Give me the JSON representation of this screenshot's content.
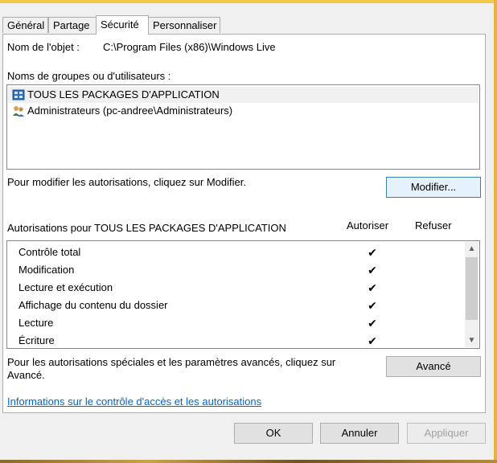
{
  "tabs": [
    {
      "label": "Général"
    },
    {
      "label": "Partage"
    },
    {
      "label": "Sécurité"
    },
    {
      "label": "Personnaliser"
    }
  ],
  "object_name": {
    "label": "Nom de l'objet :",
    "value": "C:\\Program Files (x86)\\Windows Live"
  },
  "groups": {
    "label": "Noms de groupes ou d'utilisateurs :",
    "items": [
      {
        "name": "TOUS LES PACKAGES D'APPLICATION",
        "icon": "app-packages-icon",
        "selected": true
      },
      {
        "name": "Administrateurs (pc-andree\\Administrateurs)",
        "icon": "users-group-icon",
        "selected": false
      }
    ]
  },
  "modify": {
    "hint": "Pour modifier les autorisations, cliquez sur Modifier.",
    "button": "Modifier..."
  },
  "permissions": {
    "title": "Autorisations pour TOUS LES PACKAGES D'APPLICATION",
    "allow_header": "Autoriser",
    "deny_header": "Refuser",
    "check_glyph": "✔",
    "rows": [
      {
        "name": "Contrôle total",
        "allow": true,
        "deny": false
      },
      {
        "name": "Modification",
        "allow": true,
        "deny": false
      },
      {
        "name": "Lecture et exécution",
        "allow": true,
        "deny": false
      },
      {
        "name": "Affichage du contenu du dossier",
        "allow": true,
        "deny": false
      },
      {
        "name": "Lecture",
        "allow": true,
        "deny": false
      },
      {
        "name": "Écriture",
        "allow": true,
        "deny": false
      }
    ]
  },
  "advanced": {
    "hint_line1": "Pour les autorisations spéciales et les paramètres avancés, cliquez sur",
    "hint_line2": "Avancé.",
    "button": "Avancé"
  },
  "info_link": "Informations sur le contrôle d'accès et les autorisations",
  "footer": {
    "ok": "OK",
    "cancel": "Annuler",
    "apply": "Appliquer"
  },
  "colors": {
    "link": "#0066cc",
    "focus_border": "#3c7fb1"
  }
}
